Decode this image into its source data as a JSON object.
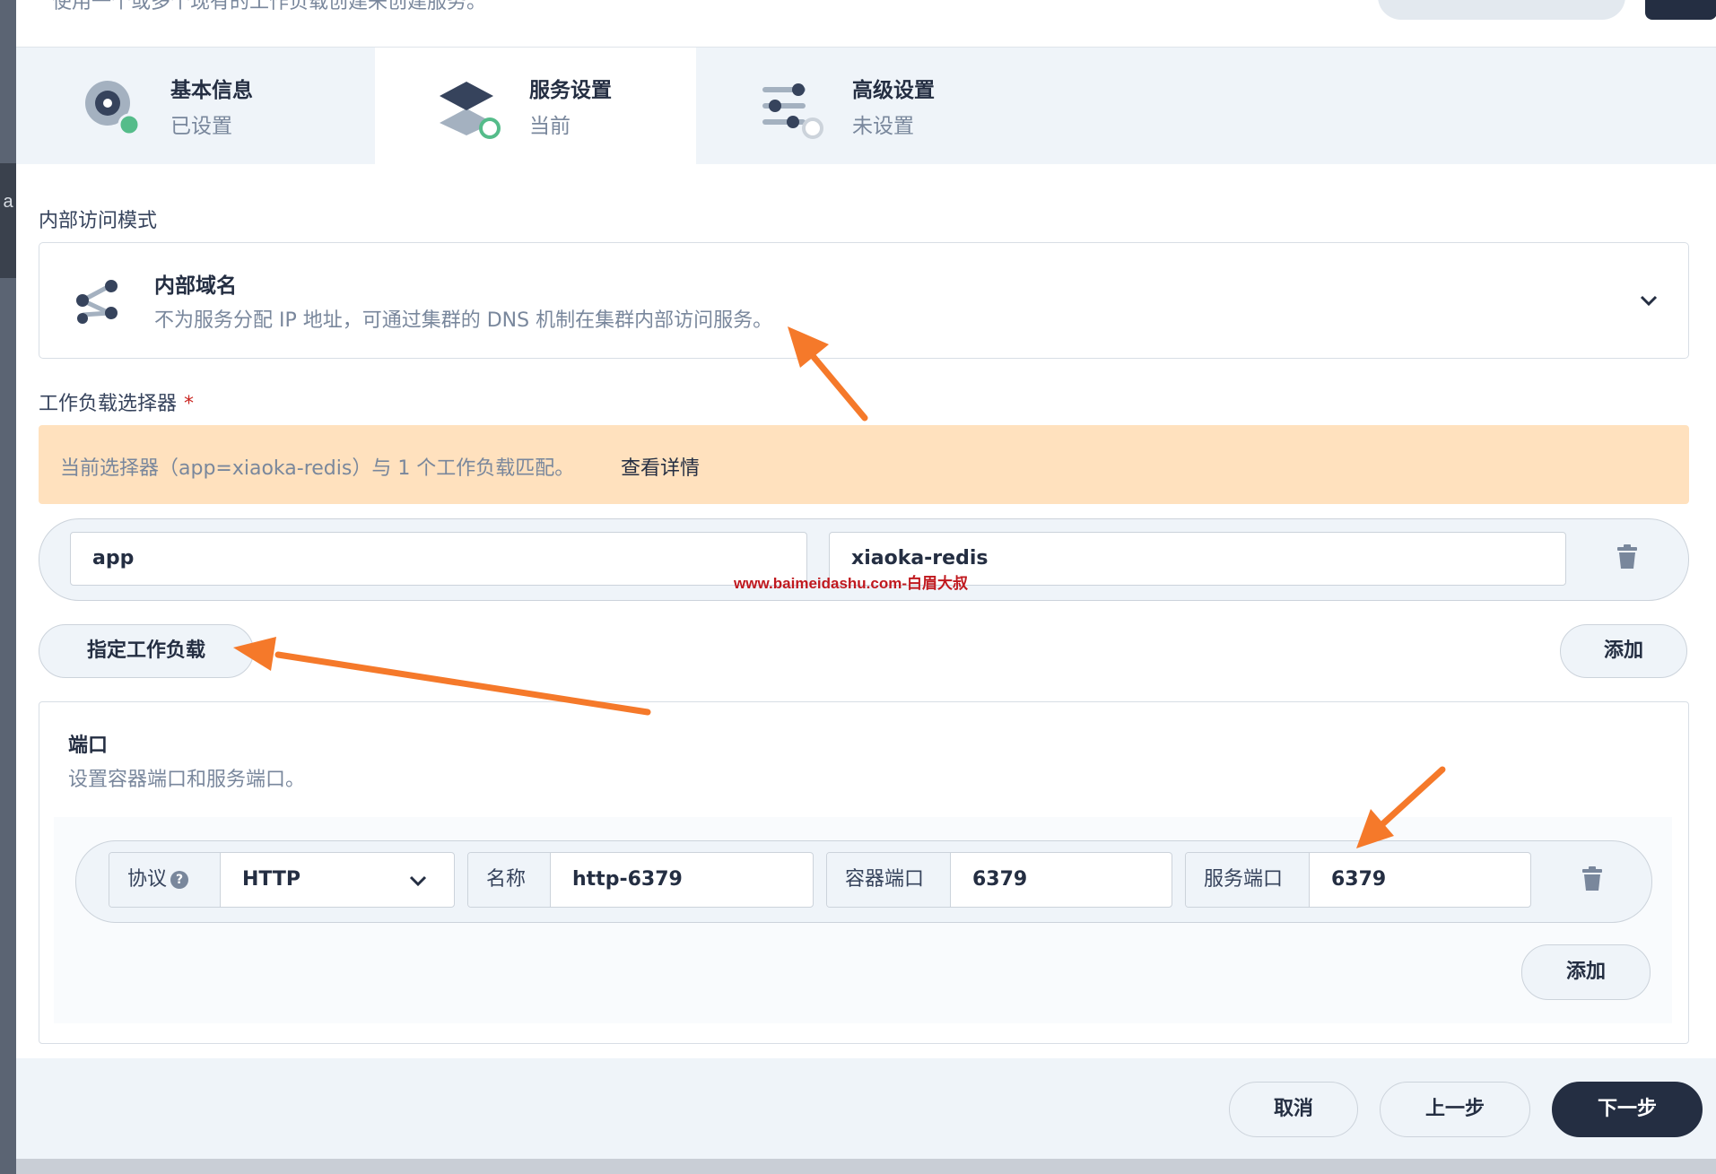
{
  "header": {
    "description": "使用一个或多个现有的工作负载创建来创建服务。"
  },
  "steps": [
    {
      "title": "基本信息",
      "status": "已设置",
      "icon": "gear-dot-icon"
    },
    {
      "title": "服务设置",
      "status": "当前",
      "icon": "layers-icon"
    },
    {
      "title": "高级设置",
      "status": "未设置",
      "icon": "sliders-icon"
    }
  ],
  "access_mode": {
    "label": "内部访问模式",
    "selected_title": "内部域名",
    "selected_description": "不为服务分配 IP 地址，可通过集群的 DNS 机制在集群内部访问服务。",
    "icon": "share-nodes-icon"
  },
  "selector": {
    "label": "工作负载选择器",
    "required_mark": "*",
    "banner_text": "当前选择器（app=xiaoka-redis）与 1 个工作负载匹配。",
    "banner_link": "查看详情",
    "key": "app",
    "value": "xiaoka-redis",
    "specify_button": "指定工作负载",
    "add_button": "添加"
  },
  "ports": {
    "title": "端口",
    "description": "设置容器端口和服务端口。",
    "protocol_label": "协议",
    "protocol_help": "?",
    "protocol_value": "HTTP",
    "name_label": "名称",
    "name_value": "http-6379",
    "container_port_label": "容器端口",
    "container_port_value": "6379",
    "service_port_label": "服务端口",
    "service_port_value": "6379",
    "add_button": "添加"
  },
  "footer": {
    "cancel": "取消",
    "previous": "上一步",
    "next": "下一步"
  },
  "watermark": "www.baimeidashu.com-白眉大叔",
  "left_strip_letter": "a",
  "colors": {
    "primary_dark": "#242e42",
    "success": "#55bc8a",
    "warning_bg": "#ffe1be",
    "annotation_arrow": "#f5792a"
  }
}
